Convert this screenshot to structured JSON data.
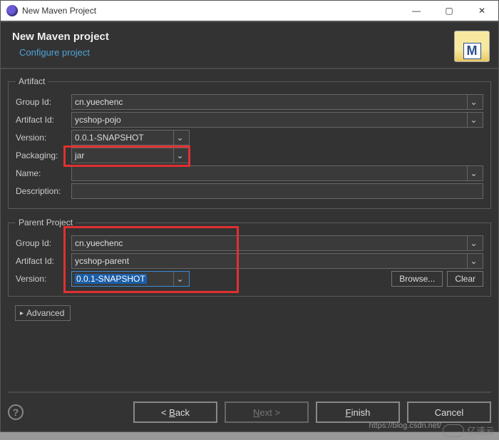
{
  "window": {
    "title": "New Maven Project",
    "minimize": "—",
    "maximize": "▢",
    "close": "✕"
  },
  "header": {
    "title": "New Maven project",
    "subtitle": "Configure project",
    "icon_letter": "M"
  },
  "artifact": {
    "legend": "Artifact",
    "group_id_label": "Group Id:",
    "group_id": "cn.yuechenc",
    "artifact_id_label": "Artifact Id:",
    "artifact_id": "ycshop-pojo",
    "version_label": "Version:",
    "version": "0.0.1-SNAPSHOT",
    "packaging_label": "Packaging:",
    "packaging": "jar",
    "name_label": "Name:",
    "name": "",
    "description_label": "Description:",
    "description": ""
  },
  "parent": {
    "legend": "Parent Project",
    "group_id_label": "Group Id:",
    "group_id": "cn.yuechenc",
    "artifact_id_label": "Artifact Id:",
    "artifact_id": "ycshop-parent",
    "version_label": "Version:",
    "version": "0.0.1-SNAPSHOT",
    "browse": "Browse...",
    "clear": "Clear"
  },
  "advanced": {
    "label": "Advanced"
  },
  "buttons": {
    "back": "< Back",
    "back_ul": "B",
    "next": "Next >",
    "next_ul": "N",
    "finish": "Finish",
    "finish_ul": "F",
    "cancel": "Cancel"
  },
  "watermark": "https://blog.csdn.net/",
  "watermark2": "亿速云",
  "icons": {
    "dropdown": "⌄",
    "tri": "▸",
    "help": "?"
  }
}
